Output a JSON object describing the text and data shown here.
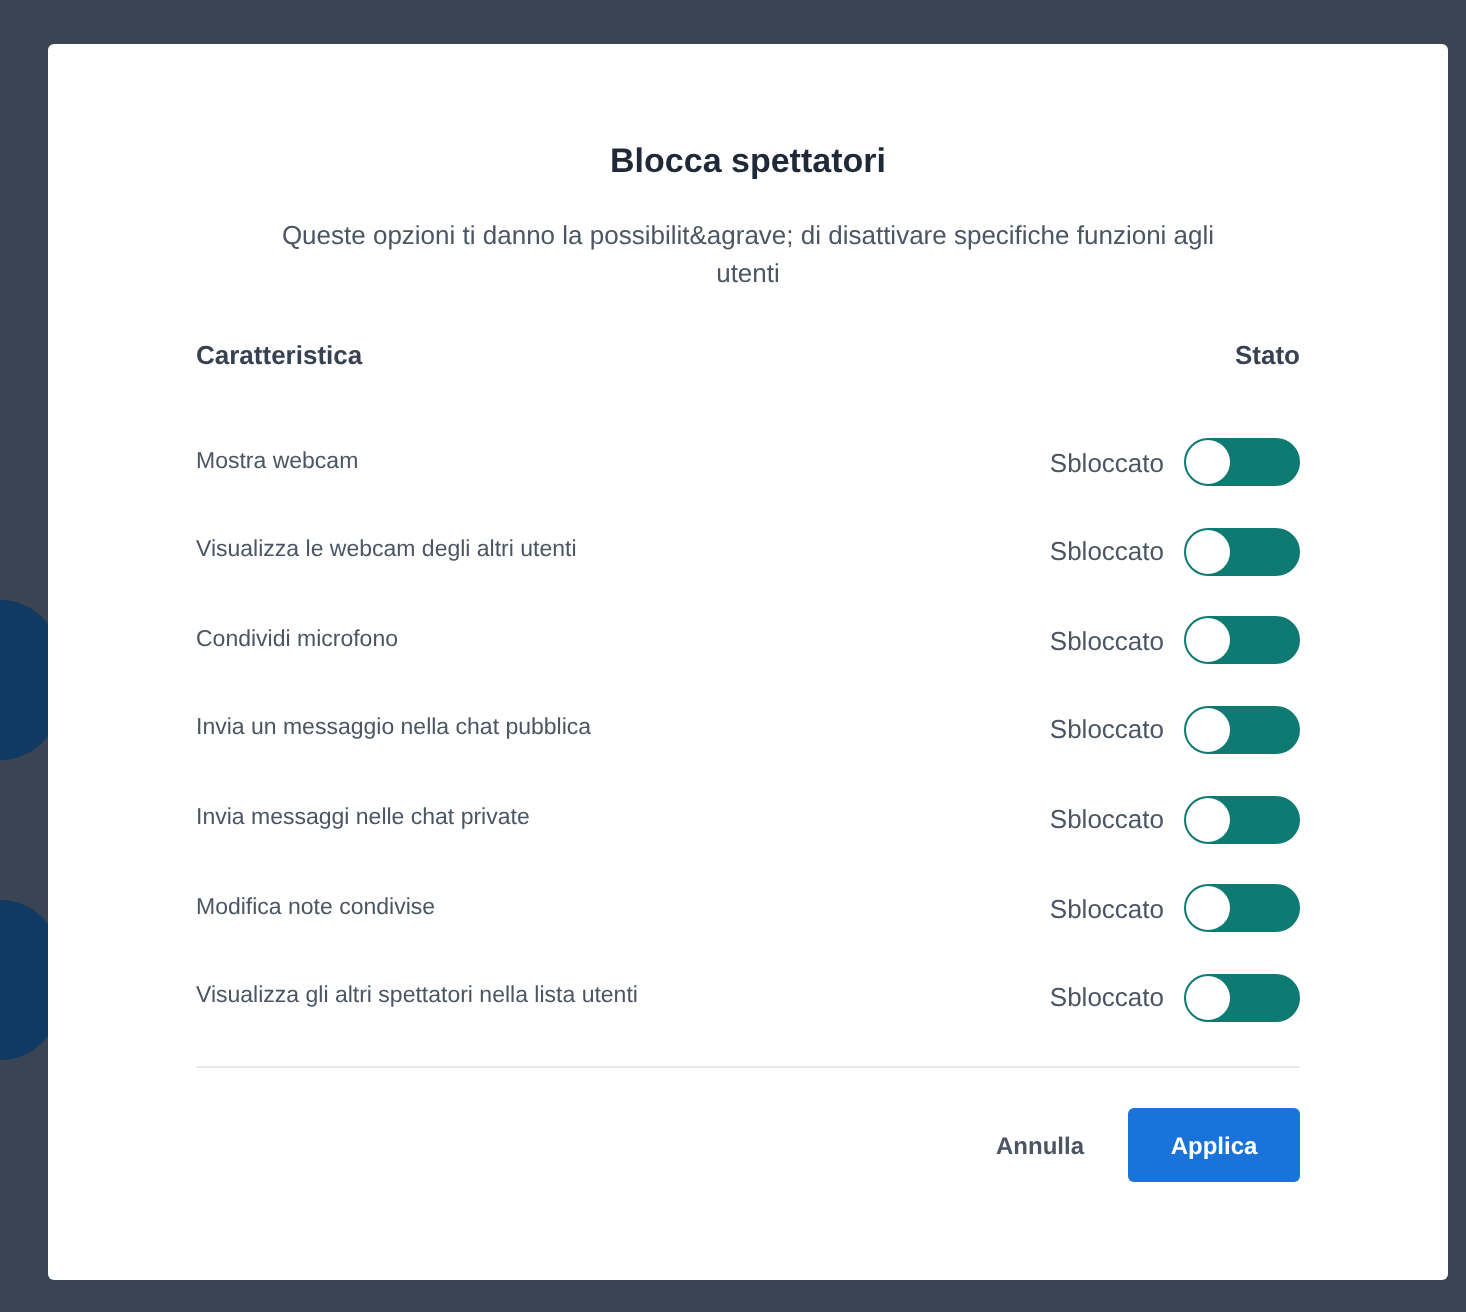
{
  "dialog": {
    "title": "Blocca spettatori",
    "description": "Queste opzioni ti danno la possibilit&agrave; di disattivare specifiche funzioni agli utenti"
  },
  "table": {
    "columns": [
      "Caratteristica",
      "Stato"
    ],
    "rows": [
      {
        "label": "Mostra webcam",
        "status": "Sbloccato",
        "locked": false
      },
      {
        "label": "Visualizza le webcam degli altri utenti",
        "status": "Sbloccato",
        "locked": false
      },
      {
        "label": "Condividi microfono",
        "status": "Sbloccato",
        "locked": false
      },
      {
        "label": "Invia un messaggio nella chat pubblica",
        "status": "Sbloccato",
        "locked": false
      },
      {
        "label": "Invia messaggi nelle chat private",
        "status": "Sbloccato",
        "locked": false
      },
      {
        "label": "Modifica note condivise",
        "status": "Sbloccato",
        "locked": false
      },
      {
        "label": "Visualizza gli altri spettatori nella lista utenti",
        "status": "Sbloccato",
        "locked": false
      }
    ]
  },
  "buttons": [
    {
      "label": "Annulla",
      "kind": "secondary"
    },
    {
      "label": "Applica",
      "kind": "primary"
    }
  ]
}
